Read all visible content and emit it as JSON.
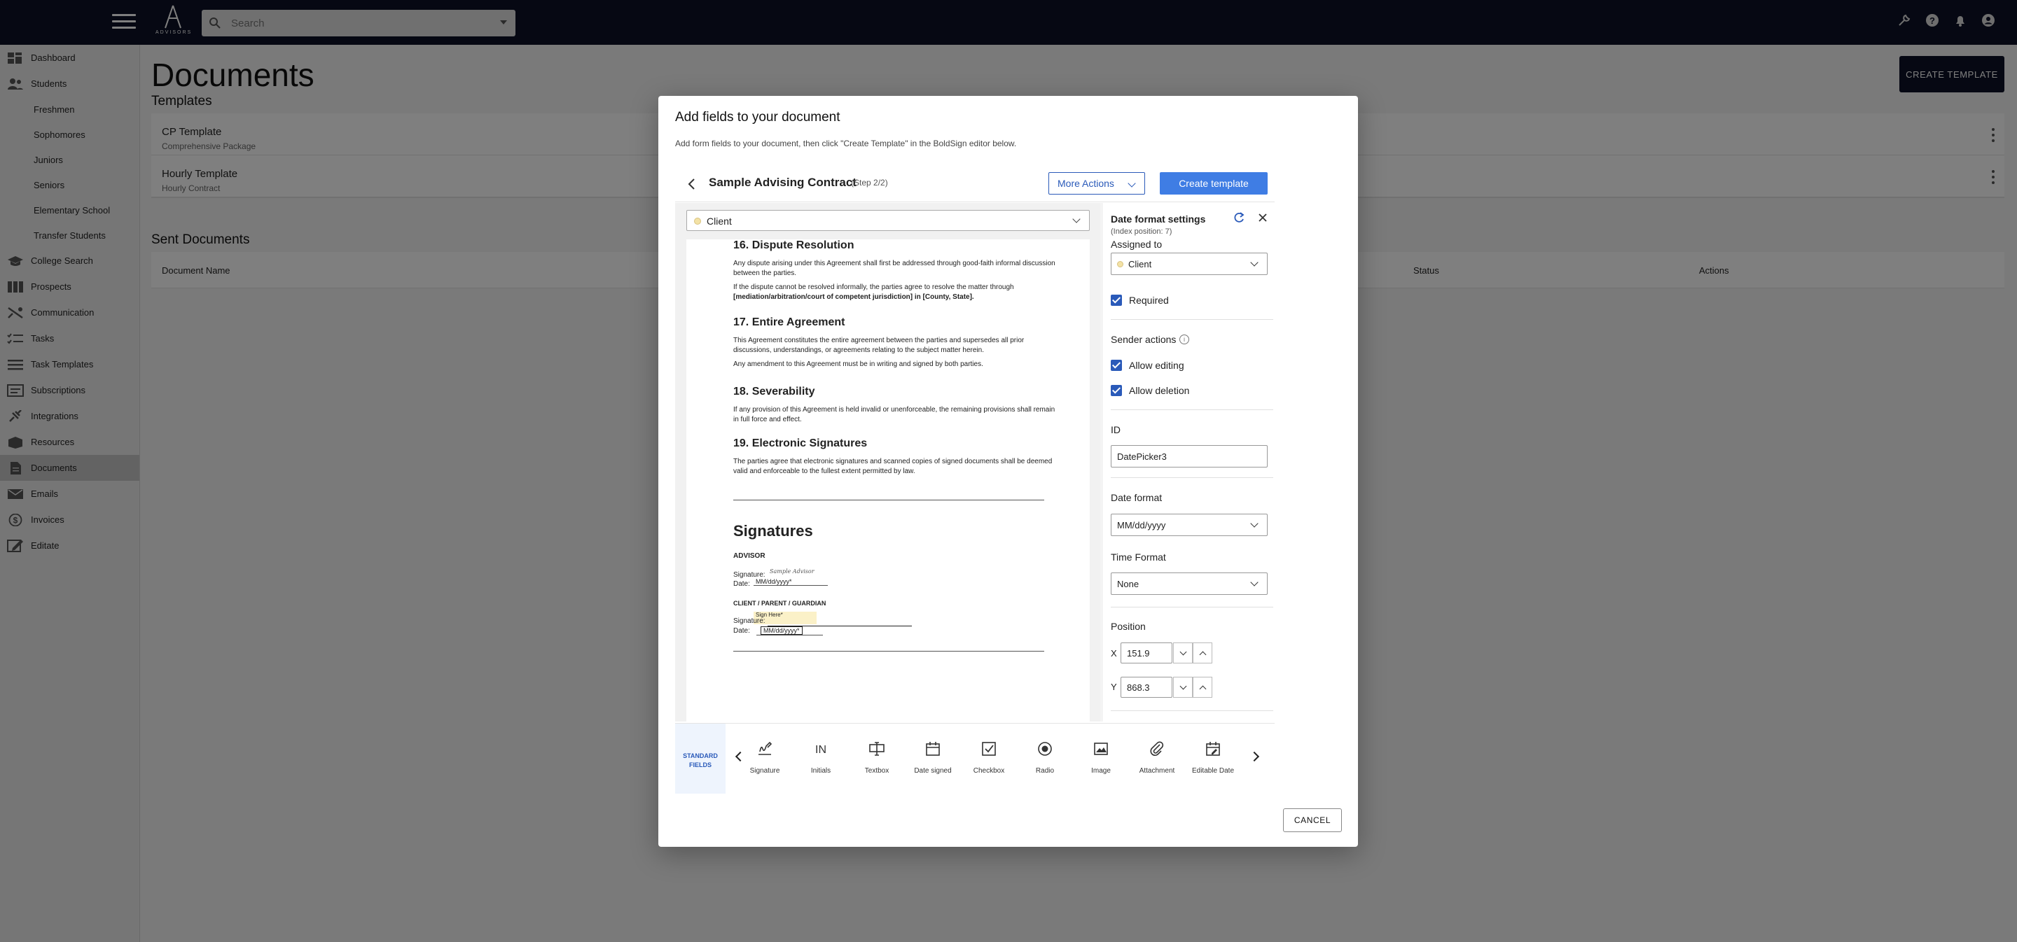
{
  "search": {
    "placeholder": "Search"
  },
  "logo": {
    "text": "ADVISORS"
  },
  "sidebar": {
    "items": [
      {
        "label": "Dashboard"
      },
      {
        "label": "Students"
      },
      {
        "label": "Freshmen"
      },
      {
        "label": "Sophomores"
      },
      {
        "label": "Juniors"
      },
      {
        "label": "Seniors"
      },
      {
        "label": "Elementary School"
      },
      {
        "label": "Transfer Students"
      },
      {
        "label": "College Search"
      },
      {
        "label": "Prospects"
      },
      {
        "label": "Communication"
      },
      {
        "label": "Tasks"
      },
      {
        "label": "Task Templates"
      },
      {
        "label": "Subscriptions"
      },
      {
        "label": "Integrations"
      },
      {
        "label": "Resources"
      },
      {
        "label": "Documents"
      },
      {
        "label": "Emails"
      },
      {
        "label": "Invoices"
      },
      {
        "label": "Editate"
      }
    ]
  },
  "page": {
    "title": "Documents",
    "create_button": "CREATE TEMPLATE",
    "templates_heading": "Templates",
    "templates": [
      {
        "name": "CP Template",
        "description": "Comprehensive Package"
      },
      {
        "name": "Hourly Template",
        "description": "Hourly Contract"
      }
    ],
    "sent_heading": "Sent Documents",
    "sent_columns": [
      "Document Name",
      "Status",
      "Actions"
    ]
  },
  "modal": {
    "title": "Add fields to your document",
    "subtitle": "Add form fields to your document, then click \"Create Template\" in the BoldSign editor below.",
    "doc_title": "Sample Advising Contract",
    "step": "(Step 2/2)",
    "more_actions": "More Actions",
    "create_template": "Create template",
    "signer_select": "Client",
    "cancel": "CANCEL",
    "document": {
      "h16": "16. Dispute Resolution",
      "p16a": "Any dispute arising under this Agreement shall first be addressed through good-faith informal discussion between the parties.",
      "p16b": "If the dispute cannot be resolved informally, the parties agree to resolve the matter through",
      "p16c": "[mediation/arbitration/court of competent jurisdiction] in [County, State].",
      "h17": "17. Entire Agreement",
      "p17a": "This Agreement constitutes the entire agreement between the parties and supersedes all prior discussions, understandings, or agreements relating to the subject matter herein.",
      "p17b": "Any amendment to this Agreement must be in writing and signed by both parties.",
      "h18": "18. Severability",
      "p18": "If any provision of this Agreement is held invalid or unenforceable, the remaining provisions shall remain in full force and effect.",
      "h19": "19. Electronic Signatures",
      "p19": "The parties agree that electronic signatures and scanned copies of signed documents shall be deemed valid and enforceable to the fullest extent permitted by law.",
      "signatures": "Signatures",
      "advisor": "ADVISOR",
      "signature_label": "Signature:",
      "date_label": "Date:",
      "advisor_sig": "Sample Advisor",
      "advisor_date": "MM/dd/yyyy*",
      "client_heading": "CLIENT / PARENT / GUARDIAN",
      "sign_here": "Sign Here*",
      "client_date": "MM/dd/yyyy*"
    },
    "settings": {
      "title": "Date format settings",
      "index": "(Index position: 7)",
      "assigned_to_label": "Assigned to",
      "assigned_to": "Client",
      "required": "Required",
      "sender_actions": "Sender actions",
      "allow_editing": "Allow editing",
      "allow_deletion": "Allow deletion",
      "id_label": "ID",
      "id_value": "DatePicker3",
      "date_format_label": "Date format",
      "date_format": "MM/dd/yyyy",
      "time_format_label": "Time Format",
      "time_format": "None",
      "position_label": "Position",
      "x_label": "X",
      "x_value": "151.9",
      "y_label": "Y",
      "y_value": "868.3"
    },
    "toolbar": {
      "standard_fields": "STANDARD FIELDS",
      "tools": [
        {
          "label": "Signature",
          "icon": "signature-icon"
        },
        {
          "label": "Initials",
          "icon": "initials-icon"
        },
        {
          "label": "Textbox",
          "icon": "textbox-icon"
        },
        {
          "label": "Date signed",
          "icon": "calendar-icon"
        },
        {
          "label": "Checkbox",
          "icon": "checkbox-icon"
        },
        {
          "label": "Radio",
          "icon": "radio-icon"
        },
        {
          "label": "Image",
          "icon": "image-icon"
        },
        {
          "label": "Attachment",
          "icon": "paperclip-icon"
        },
        {
          "label": "Editable Date",
          "icon": "editable-date-icon"
        }
      ]
    }
  },
  "colors": {
    "topbar": "#0c1126",
    "accent": "#3f7de4",
    "link": "#2a5ab9"
  }
}
